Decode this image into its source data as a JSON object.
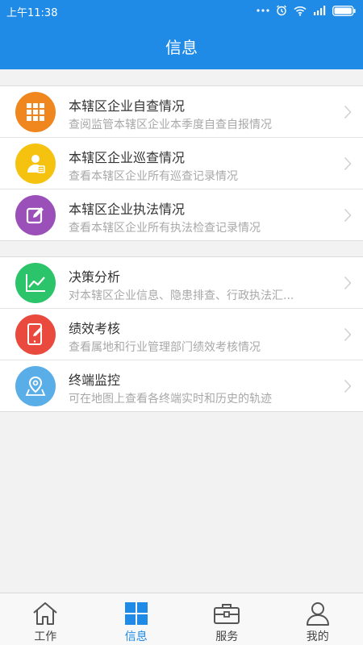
{
  "status_bar": {
    "time": "上午11:38",
    "icons": [
      "more-icon",
      "alarm-icon",
      "wifi-icon",
      "signal-icon",
      "battery-icon"
    ]
  },
  "header": {
    "title": "信息"
  },
  "groups": [
    {
      "items": [
        {
          "title": "本辖区企业自查情况",
          "desc": "查阅监管本辖区企业本季度自查自报情况",
          "icon": "grid-icon",
          "color": "#f0871e"
        },
        {
          "title": "本辖区企业巡查情况",
          "desc": "查看本辖区企业所有巡查记录情况",
          "icon": "inspector-icon",
          "color": "#f5c30f"
        },
        {
          "title": "本辖区企业执法情况",
          "desc": "查看本辖区企业所有执法检查记录情况",
          "icon": "edit-icon",
          "color": "#9b4fb8"
        }
      ]
    },
    {
      "items": [
        {
          "title": "决策分析",
          "desc": "对本辖区企业信息、隐患排查、行政执法汇...",
          "icon": "line-chart-icon",
          "color": "#2bc46a"
        },
        {
          "title": "绩效考核",
          "desc": "查看属地和行业管理部门绩效考核情况",
          "icon": "tablet-edit-icon",
          "color": "#e94a3d"
        },
        {
          "title": "终端监控",
          "desc": "可在地图上查看各终端实时和历史的轨迹",
          "icon": "map-pin-icon",
          "color": "#5aaee8"
        }
      ]
    }
  ],
  "tab_bar": {
    "tabs": [
      {
        "label": "工作",
        "icon": "home-icon",
        "active": false
      },
      {
        "label": "信息",
        "icon": "windows-icon",
        "active": true
      },
      {
        "label": "服务",
        "icon": "toolbox-icon",
        "active": false
      },
      {
        "label": "我的",
        "icon": "person-icon",
        "active": false
      }
    ]
  },
  "colors": {
    "primary": "#1f8be6",
    "background": "#f2f2f2",
    "active_tab": "#1f8be6"
  }
}
